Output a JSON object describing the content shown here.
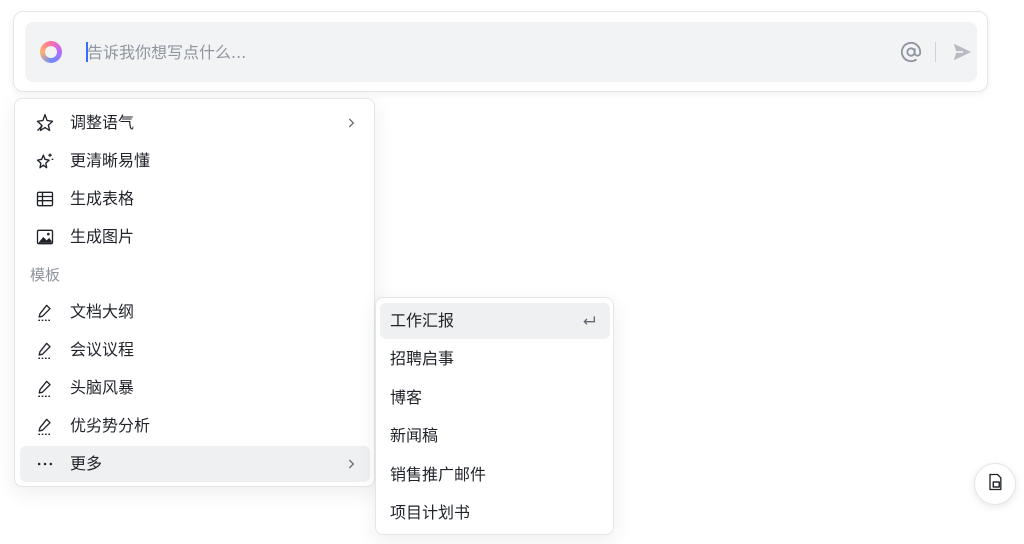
{
  "prompt": {
    "placeholder": "告诉我你想写点什么...",
    "value": ""
  },
  "menu": {
    "items": [
      {
        "label": "调整语气",
        "icon": "magic-stars-icon",
        "has_submenu": true
      },
      {
        "label": "更清晰易懂",
        "icon": "sparkle-stars-icon",
        "has_submenu": false
      },
      {
        "label": "生成表格",
        "icon": "table-icon",
        "has_submenu": false
      },
      {
        "label": "生成图片",
        "icon": "image-icon",
        "has_submenu": false
      }
    ],
    "section_label": "模板",
    "template_items": [
      {
        "label": "文档大纲",
        "icon": "pen-icon"
      },
      {
        "label": "会议议程",
        "icon": "pen-icon"
      },
      {
        "label": "头脑风暴",
        "icon": "pen-icon"
      },
      {
        "label": "优劣势分析",
        "icon": "pen-icon"
      }
    ],
    "more": {
      "label": "更多",
      "icon": "ellipsis-icon",
      "has_submenu": true
    }
  },
  "submenu": {
    "items": [
      {
        "label": "工作汇报",
        "active": true
      },
      {
        "label": "招聘启事"
      },
      {
        "label": "博客"
      },
      {
        "label": "新闻稿"
      },
      {
        "label": "销售推广邮件"
      },
      {
        "label": "项目计划书"
      }
    ]
  },
  "colors": {
    "accent": "#3370ff",
    "text": "#1f2329",
    "muted": "#8f959e",
    "hover_bg": "#eff0f1",
    "input_bg": "#f2f3f5"
  }
}
